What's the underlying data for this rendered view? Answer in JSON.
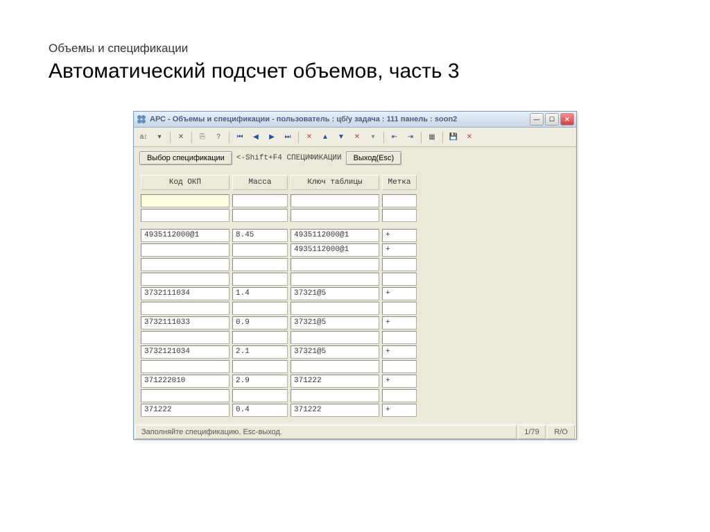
{
  "page": {
    "subtitle": "Объемы и спецификации",
    "title": "Автоматический подсчет объемов, часть 3"
  },
  "window": {
    "title": "АРС - Объемы и спецификации -   пользователь : цб/у  задача : 111  панель : soon2"
  },
  "toolbar": {
    "font": "a↕",
    "nav_first": "⏮",
    "nav_prev": "◀",
    "nav_next": "▶",
    "nav_last": "⏭"
  },
  "actionbar": {
    "select_spec": "Выбор спецификации",
    "hint": "<-Shift+F4 СПЕЦИФИКАЦИИ",
    "exit": "Выход(Esc)"
  },
  "columns": {
    "c1": "Код ОКП",
    "c2": "Масса",
    "c3": "Ключ таблицы",
    "c4": "Метка"
  },
  "rows": [
    {
      "c1": "",
      "c2": "",
      "c3": "",
      "c4": "",
      "highlight": true
    },
    {
      "c1": "",
      "c2": "",
      "c3": "",
      "c4": ""
    },
    {
      "spacer": true
    },
    {
      "c1": "4935112000@1",
      "c2": "8.45",
      "c3": "4935112000@1",
      "c4": "+"
    },
    {
      "c1": "",
      "c2": "",
      "c3": "4935112000@1",
      "c4": "+"
    },
    {
      "c1": "",
      "c2": "",
      "c3": "",
      "c4": ""
    },
    {
      "c1": "",
      "c2": "",
      "c3": "",
      "c4": ""
    },
    {
      "c1": "3732111034",
      "c2": "1.4",
      "c3": "37321@5",
      "c4": "+"
    },
    {
      "c1": "",
      "c2": "",
      "c3": "",
      "c4": ""
    },
    {
      "c1": "3732111033",
      "c2": "0.9",
      "c3": "37321@5",
      "c4": "+"
    },
    {
      "c1": "",
      "c2": "",
      "c3": "",
      "c4": ""
    },
    {
      "c1": "3732121034",
      "c2": "2.1",
      "c3": "37321@5",
      "c4": "+"
    },
    {
      "c1": "",
      "c2": "",
      "c3": "",
      "c4": ""
    },
    {
      "c1": "371222010",
      "c2": "2.9",
      "c3": "371222",
      "c4": "+"
    },
    {
      "c1": "",
      "c2": "",
      "c3": "",
      "c4": ""
    },
    {
      "c1": "371222",
      "c2": "0.4",
      "c3": "371222",
      "c4": "+"
    }
  ],
  "statusbar": {
    "message": "Заполняйте спецификацию. Esc-выход.",
    "position": "1/79",
    "mode": "R/O"
  }
}
